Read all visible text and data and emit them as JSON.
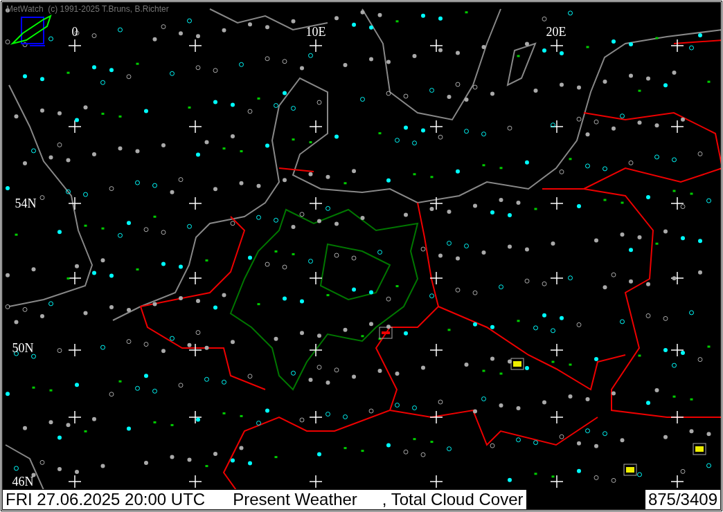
{
  "window": {
    "title": "MetWatch  (c) 1991-2025 T.Bruns, B.Richter"
  },
  "map": {
    "grid_labels": [
      "0",
      "10E",
      "20E",
      "54N",
      "50N",
      "46N"
    ]
  },
  "status_bar": {
    "datetime": "FRI 27.06.2025 20:00 UTC",
    "product": "Present Weather",
    "product_suffix": ", Total Cloud Cover",
    "count": "875/3409"
  }
}
